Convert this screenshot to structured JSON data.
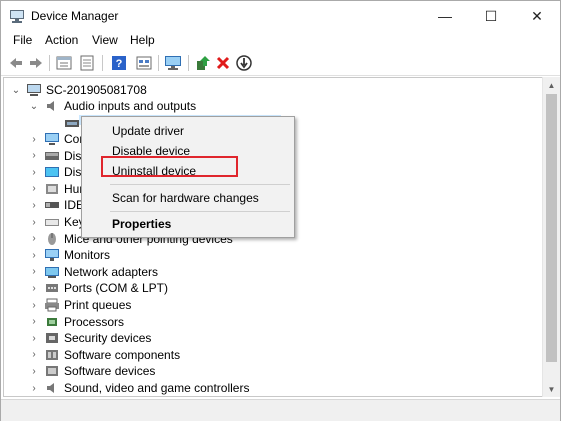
{
  "window": {
    "title": "Device Manager",
    "minimize_glyph": "—",
    "maximize_glyph": "☐",
    "close_glyph": "✕"
  },
  "menu": [
    "File",
    "Action",
    "View",
    "Help"
  ],
  "toolbar": [
    "back-icon",
    "forward-icon",
    "properties-icon",
    "show-hide-icon",
    "help-icon",
    "action-properties-icon",
    "scan-computer-icon",
    "update-driver-icon",
    "uninstall-icon",
    "disable-icon"
  ],
  "tree": {
    "root": "SC-201905081708",
    "audio_group": "Audio inputs and outputs",
    "items": [
      {
        "label": "Com",
        "icon": "computer-icon"
      },
      {
        "label": "Disk",
        "icon": "disk-drive-icon"
      },
      {
        "label": "Disp",
        "icon": "display-adapter-icon"
      },
      {
        "label": "Hum",
        "icon": "human-interface-icon"
      },
      {
        "label": "IDE",
        "icon": "ide-controller-icon"
      },
      {
        "label": "Key",
        "icon": "keyboard-icon"
      },
      {
        "label": "Mice and other pointing devices",
        "icon": "mouse-icon"
      },
      {
        "label": "Monitors",
        "icon": "monitor-icon"
      },
      {
        "label": "Network adapters",
        "icon": "network-adapter-icon"
      },
      {
        "label": "Ports (COM & LPT)",
        "icon": "port-icon"
      },
      {
        "label": "Print queues",
        "icon": "printer-icon"
      },
      {
        "label": "Processors",
        "icon": "processor-icon"
      },
      {
        "label": "Security devices",
        "icon": "security-device-icon"
      },
      {
        "label": "Software components",
        "icon": "software-component-icon"
      },
      {
        "label": "Software devices",
        "icon": "software-device-icon"
      },
      {
        "label": "Sound, video and game controllers",
        "icon": "sound-icon"
      }
    ]
  },
  "context_menu": {
    "update": "Update driver",
    "disable": "Disable device",
    "uninstall": "Uninstall device",
    "scan": "Scan for hardware changes",
    "properties": "Properties"
  },
  "colors": {
    "highlight_border": "#e0262d",
    "selection": "#cce8ff"
  }
}
